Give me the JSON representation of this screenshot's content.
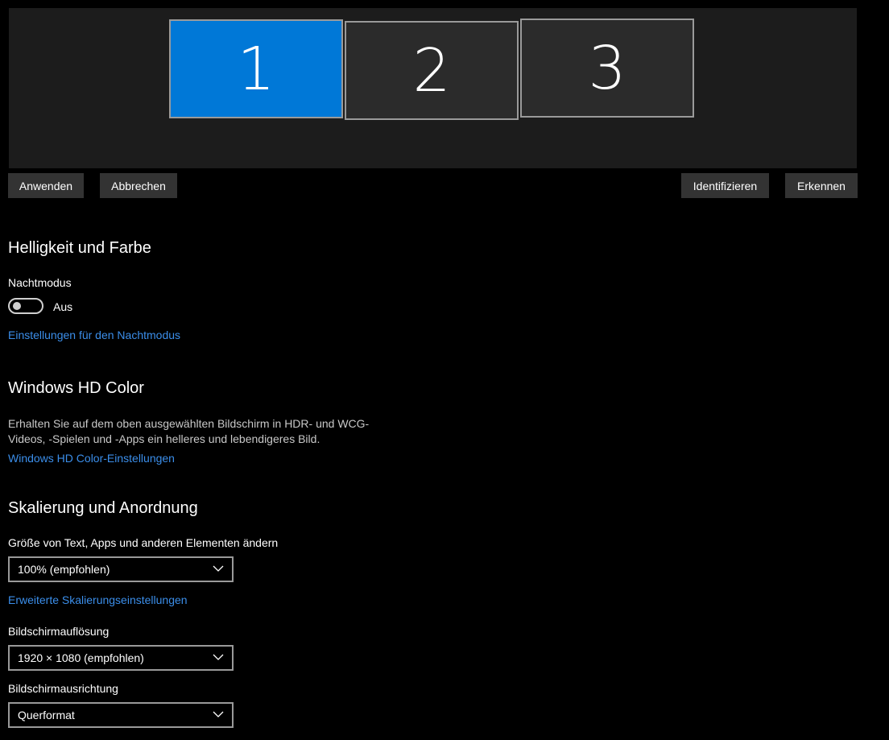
{
  "display": {
    "monitors": [
      {
        "label": "1",
        "selected": true
      },
      {
        "label": "2",
        "selected": false
      },
      {
        "label": "3",
        "selected": false
      }
    ],
    "buttons": {
      "apply": "Anwenden",
      "cancel": "Abbrechen",
      "identify": "Identifizieren",
      "detect": "Erkennen"
    }
  },
  "brightness": {
    "heading": "Helligkeit und Farbe",
    "night_mode_label": "Nachtmodus",
    "night_mode_state": "Aus",
    "night_mode_on": false,
    "night_mode_link": "Einstellungen für den Nachtmodus"
  },
  "hdcolor": {
    "heading": "Windows HD Color",
    "description": "Erhalten Sie auf dem oben ausgewählten Bildschirm in HDR- und WCG-Videos, -Spielen und -Apps ein helleres und lebendigeres Bild.",
    "link": "Windows HD Color-Einstellungen"
  },
  "scaling": {
    "heading": "Skalierung und Anordnung",
    "size_label": "Größe von Text, Apps und anderen Elementen ändern",
    "size_value": "100% (empfohlen)",
    "advanced_link": "Erweiterte Skalierungseinstellungen",
    "resolution_label": "Bildschirmauflösung",
    "resolution_value": "1920 × 1080 (empfohlen)",
    "orientation_label": "Bildschirmausrichtung",
    "orientation_value": "Querformat"
  },
  "colors": {
    "accent": "#0078d7",
    "link": "#3b8eea",
    "background": "#000000"
  }
}
